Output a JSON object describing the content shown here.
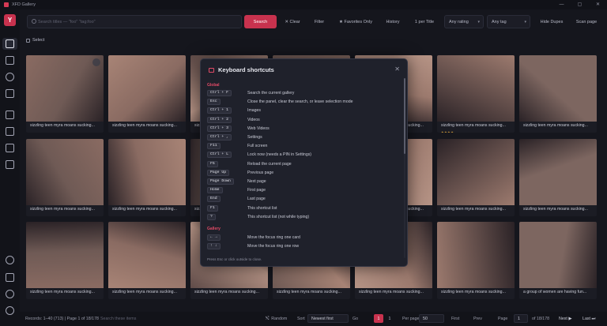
{
  "window": {
    "title": "XFD Gallery",
    "controls": [
      "—",
      "▢",
      "✕"
    ]
  },
  "sidebar": {
    "logo": "Y",
    "items": [
      "gallery-icon",
      "images-icon",
      "videos-icon",
      "web-icon",
      "folder-icon",
      "tag-icon",
      "duplicate-icon",
      "collection-icon",
      "chat-icon",
      "info-icon",
      "settings-icon",
      "theme-icon"
    ]
  },
  "toolbar": {
    "search_placeholder": "Search titles — \"foo\" \"tag:foo\"",
    "search_label": "Search",
    "clear_label": "✕ Clear",
    "filter_label": "Filter",
    "favorites_label": "★ Favorites Only",
    "history_label": "History",
    "per_title_label": "1 per Title",
    "rating_value": "Any rating",
    "tag_value": "Any tag",
    "hide_dupes_label": "Hide Dupes",
    "scan_label": "Scan page"
  },
  "selectbar": {
    "label": "Select"
  },
  "cards": [
    {
      "caption": "sizzling teen myra moans sucking...",
      "stars": ""
    },
    {
      "caption": "sizzling teen myra moans sucking...",
      "stars": ""
    },
    {
      "caption": "sizzling teen myra moans sucking...",
      "stars": ""
    },
    {
      "caption": "sizzling teen myra moans sucking...",
      "stars": ""
    },
    {
      "caption": "sizzling teen myra moans sucking...",
      "stars": ""
    },
    {
      "caption": "sizzling teen myra moans sucking...",
      "stars": "★★★★"
    },
    {
      "caption": "sizzling teen myra moans sucking...",
      "stars": ""
    },
    {
      "caption": "sizzling teen myra moans sucking...",
      "stars": ""
    },
    {
      "caption": "sizzling teen myra moans sucking...",
      "stars": ""
    },
    {
      "caption": "sizzling teen myra moans sucking...",
      "stars": ""
    },
    {
      "caption": "sizzling teen myra moans sucking...",
      "stars": ""
    },
    {
      "caption": "sizzling teen myra moans sucking...",
      "stars": ""
    },
    {
      "caption": "sizzling teen myra moans sucking...",
      "stars": ""
    },
    {
      "caption": "sizzling teen myra moans sucking...",
      "stars": ""
    },
    {
      "caption": "sizzling teen myra moans sucking...",
      "stars": ""
    },
    {
      "caption": "sizzling teen myra moans sucking...",
      "stars": ""
    },
    {
      "caption": "sizzling teen myra moans sucking...",
      "stars": ""
    },
    {
      "caption": "sizzling teen myra moans sucking...",
      "stars": ""
    },
    {
      "caption": "sizzling teen myra moans sucking...",
      "stars": ""
    },
    {
      "caption": "sizzling teen myra moans sucking...",
      "stars": ""
    },
    {
      "caption": "a group of women are having fun...",
      "stars": ""
    }
  ],
  "shortcuts": {
    "title": "Keyboard shortcuts",
    "global_label": "Global",
    "global": [
      {
        "key": "Ctrl + F",
        "desc": "Search the current gallery"
      },
      {
        "key": "Esc",
        "desc": "Close the panel, clear the search, or leave selection mode"
      },
      {
        "key": "Ctrl + 1",
        "desc": "Images"
      },
      {
        "key": "Ctrl + 2",
        "desc": "Videos"
      },
      {
        "key": "Ctrl + 3",
        "desc": "Web Videos"
      },
      {
        "key": "Ctrl + ,",
        "desc": "Settings"
      },
      {
        "key": "F11",
        "desc": "Full screen"
      },
      {
        "key": "Ctrl + L",
        "desc": "Lock now (needs a PIN in Settings)"
      },
      {
        "key": "F5",
        "desc": "Reload the current page"
      },
      {
        "key": "Page Up",
        "desc": "Previous page"
      },
      {
        "key": "Page Down",
        "desc": "Next page"
      },
      {
        "key": "Home",
        "desc": "First page"
      },
      {
        "key": "End",
        "desc": "Last page"
      },
      {
        "key": "F1",
        "desc": "This shortcut list"
      },
      {
        "key": "?",
        "desc": "This shortcut list (not while typing)"
      }
    ],
    "gallery_label": "Gallery",
    "gallery": [
      {
        "key": "← →",
        "desc": "Move the focus ring one card"
      },
      {
        "key": "↑ ↓",
        "desc": "Move the focus ring one row"
      }
    ],
    "footer": "Press Esc or click outside to close."
  },
  "bottombar": {
    "records": "Records: 1–40 (713) | Page 1 of 18/178",
    "search_hint": "Search these items",
    "random_label": "Random",
    "sort_label": "Sort",
    "sort_value": "Newest first",
    "go_label": "Go",
    "pages": [
      "1",
      "1"
    ],
    "per_page_label": "Per page",
    "per_page_value": "50",
    "first_label": "First",
    "prev_label": "Prev",
    "page_label": "Page",
    "page_value": "1",
    "of_label": "of 18/178",
    "next_label": "Next ▶",
    "last_label": "Last ⏭"
  }
}
